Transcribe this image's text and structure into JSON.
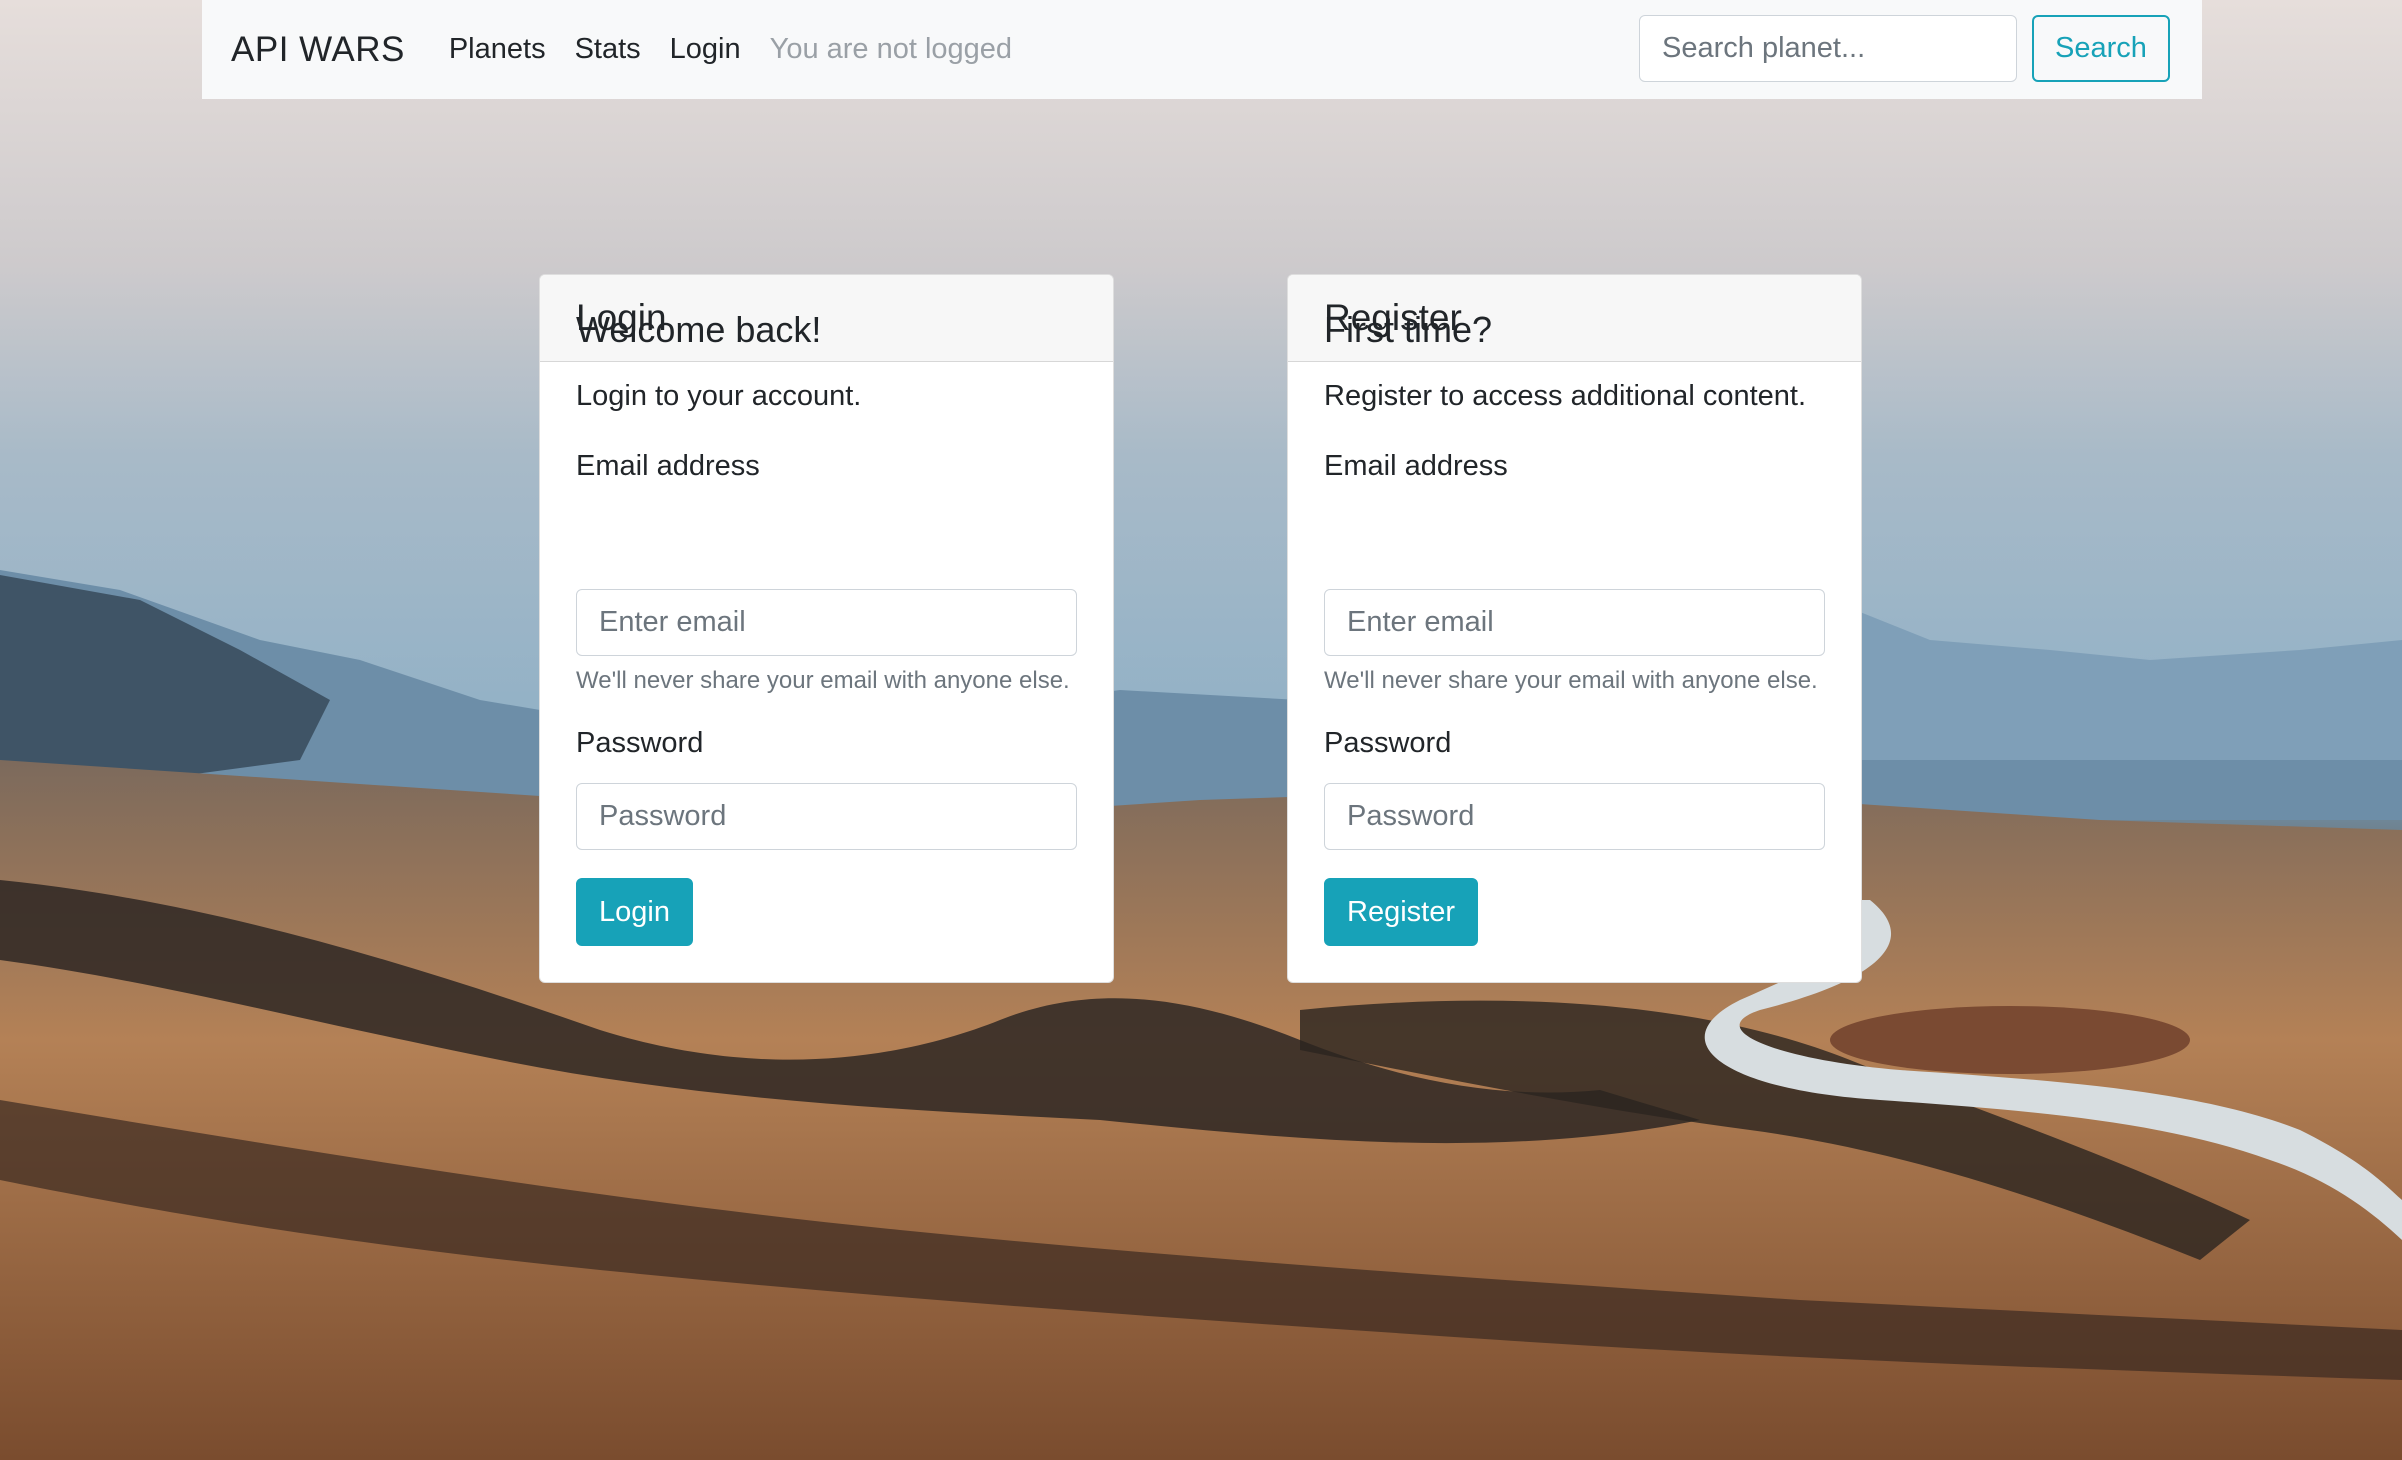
{
  "navbar": {
    "brand": "API WARS",
    "links": [
      "Planets",
      "Stats",
      "Login"
    ],
    "status": "You are not logged",
    "search_placeholder": "Search planet...",
    "search_label": "Search"
  },
  "login_card": {
    "header": "Login",
    "title": "Welcome back!",
    "text": "Login to your account.",
    "email_label": "Email address",
    "email_placeholder": "Enter email",
    "email_help": "We'll never share your email with anyone else.",
    "password_label": "Password",
    "password_placeholder": "Password",
    "button_label": "Login"
  },
  "register_card": {
    "header": "Register",
    "title": "First time?",
    "text": "Register to access additional content.",
    "email_label": "Email address",
    "email_placeholder": "Enter email",
    "email_help": "We'll never share your email with anyone else.",
    "password_label": "Password",
    "password_placeholder": "Password",
    "button_label": "Register"
  },
  "colors": {
    "accent": "#17a2b8",
    "navbar_bg": "#f8f9fa"
  }
}
